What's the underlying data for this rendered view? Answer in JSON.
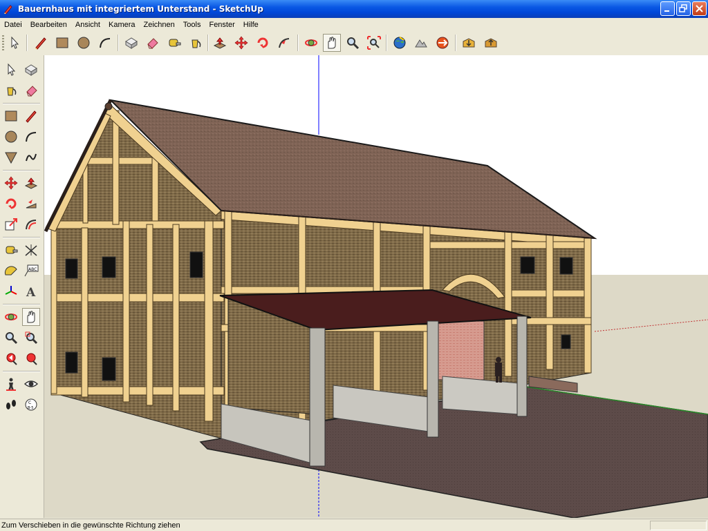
{
  "window": {
    "title": "Bauernhaus mit integriertem Unterstand - SketchUp"
  },
  "menu": [
    "Datei",
    "Bearbeiten",
    "Ansicht",
    "Kamera",
    "Zeichnen",
    "Tools",
    "Fenster",
    "Hilfe"
  ],
  "toolbar_top": [
    "select-tool",
    "pencil-line-tool",
    "rectangle-tool",
    "circle-tool",
    "arc-tool",
    "make-component-tool",
    "eraser-tool",
    "tape-measure-tool",
    "paint-bucket-tool",
    "push-pull-tool",
    "move-tool",
    "rotate-tool",
    "follow-me-tool",
    "orbit-tool",
    "pan-tool",
    "zoom-tool",
    "zoom-extents-tool",
    "get-models-tool",
    "share-model-tool",
    "google-earth-tool",
    "components-tool",
    "warehouse-tool"
  ],
  "active_tool": "pan-tool",
  "toolbar_left": [
    "select-tool",
    "make-component-tool",
    "paint-bucket-tool",
    "eraser-tool",
    "rectangle-tool",
    "line-tool",
    "circle-tool",
    "arc-tool",
    "polygon-tool",
    "freehand-tool",
    "move-tool",
    "push-pull-tool",
    "rotate-tool",
    "follow-me-tool",
    "scale-tool",
    "offset-tool",
    "tape-measure-tool",
    "dimension-tool",
    "protractor-tool",
    "text-tool",
    "axes-tool",
    "3d-text-tool",
    "orbit-tool",
    "pan-tool",
    "zoom-tool",
    "zoom-window-tool",
    "previous-view-tool",
    "zoom-extents-tool",
    "position-camera-tool",
    "look-around-tool",
    "walk-tool",
    "section-plane-tool"
  ],
  "status": {
    "text": "Zum Verschieben in die gewünschte Richtung ziehen"
  },
  "colors": {
    "sky": "#ffffff",
    "ground": "#ddd9c7",
    "roof": "#7f6355",
    "timber": "#f0d190",
    "wall_fill": "#8a7350",
    "slab": "#5a4a48",
    "brick": "#d89a8e",
    "concrete": "#c8c6bf",
    "axis_blue": "#0000ff"
  }
}
